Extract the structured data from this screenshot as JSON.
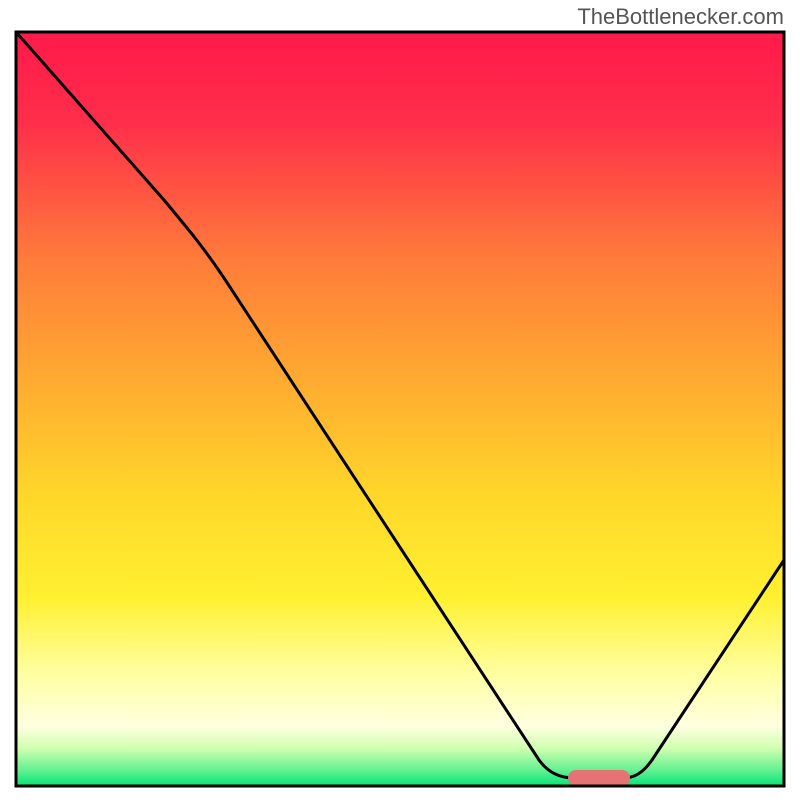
{
  "watermark": "TheBottlenecker.com",
  "chart_data": {
    "type": "line",
    "title": "",
    "xlabel": "",
    "ylabel": "",
    "xlim": [
      0,
      100
    ],
    "ylim": [
      0,
      100
    ],
    "gradient_colors": {
      "top": "#ff1744",
      "mid_upper": "#ff9800",
      "mid": "#ffeb3b",
      "mid_lower": "#ffffcc",
      "bottom": "#00e676"
    },
    "curve_points": [
      {
        "x": 0,
        "y": 100
      },
      {
        "x": 20,
        "y": 78
      },
      {
        "x": 25,
        "y": 72
      },
      {
        "x": 68,
        "y": 3
      },
      {
        "x": 72,
        "y": 2
      },
      {
        "x": 78,
        "y": 2
      },
      {
        "x": 80,
        "y": 3
      },
      {
        "x": 100,
        "y": 30
      }
    ],
    "minimum_marker": {
      "x_start": 72,
      "x_end": 79,
      "y": 2.5,
      "color": "#e57373"
    },
    "border": {
      "color": "#000000",
      "width": 3
    }
  }
}
